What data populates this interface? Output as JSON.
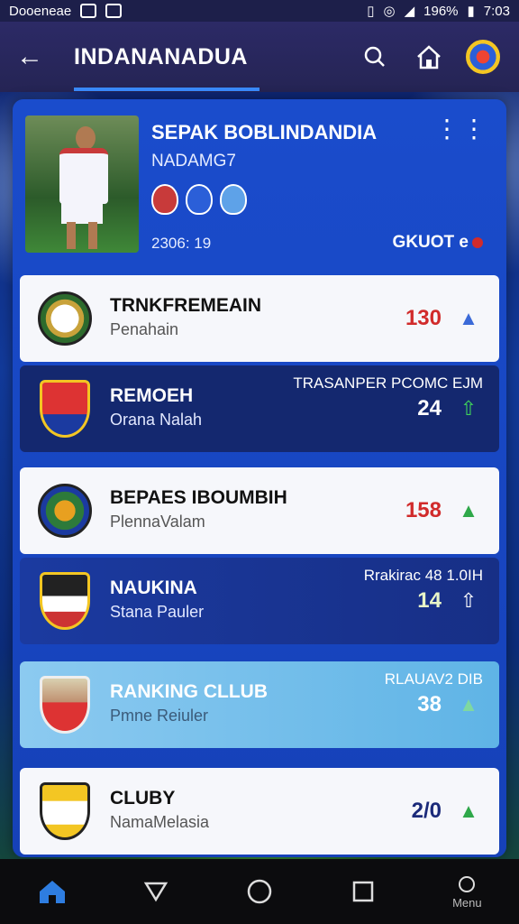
{
  "status_bar": {
    "left_text": "Dooeneae",
    "battery": "196%",
    "time": "7:03"
  },
  "app_bar": {
    "title": "INDANANADUA",
    "icons": [
      "back-arrow-icon",
      "search-icon",
      "home-icon",
      "club-logo-icon"
    ]
  },
  "hero": {
    "name": "SEPAK BOBLINDANDIA",
    "subtitle": "NADAMG7",
    "date": "2306: 19",
    "status": "GKUOT e",
    "status_dot_color": "#d12b2b",
    "crest_colors": [
      "#c83a3a",
      "#2b5fd8",
      "#5ea2e8"
    ]
  },
  "rows": [
    {
      "title": "TRNKFREMEAIN",
      "subtitle": "Penahain",
      "caption": "",
      "value": "130",
      "value_color": "#d12b2b",
      "arrow": "up",
      "arrow_color": "#3b6ad8",
      "style": "light"
    },
    {
      "title": "REMOEH",
      "subtitle": "Orana Nalah",
      "caption": "TRASANPER PCOMC EJM",
      "value": "24",
      "value_color": "#ffffff",
      "arrow": "up",
      "arrow_color": "#3fd45a",
      "style": "darker"
    },
    {
      "title": "BEPAES IBOUMBIH",
      "subtitle": "PlennaValam",
      "caption": "",
      "value": "158",
      "value_color": "#d12b2b",
      "arrow": "up",
      "arrow_color": "#2fa84a",
      "style": "light"
    },
    {
      "title": "NAUKINA",
      "subtitle": "Stana Pauler",
      "caption": "Rrakirac 48 1.0IH",
      "value": "14",
      "value_color": "#e8f5c8",
      "arrow": "up",
      "arrow_color": "#ffffff",
      "style": "dark"
    },
    {
      "title": "RANKING CLLUB",
      "subtitle": "Pmne Reiuler",
      "caption": "RLAUAV2 DIB",
      "value": "38",
      "value_color": "#ffffff",
      "arrow": "up",
      "arrow_color": "#7fd8a0",
      "style": "sky"
    },
    {
      "title": "CLUBY",
      "subtitle": "NamaMelasia",
      "caption": "",
      "value": "2/0",
      "value_color": "#1b2a7a",
      "arrow": "up",
      "arrow_color": "#2fa84a",
      "style": "light"
    }
  ],
  "nav": {
    "items": [
      {
        "icon": "home-icon",
        "label": ""
      },
      {
        "icon": "back-triangle-icon",
        "label": ""
      },
      {
        "icon": "circle-home-icon",
        "label": ""
      },
      {
        "icon": "recent-apps-icon",
        "label": ""
      },
      {
        "icon": "menu-icon",
        "label": "Menu"
      }
    ]
  }
}
